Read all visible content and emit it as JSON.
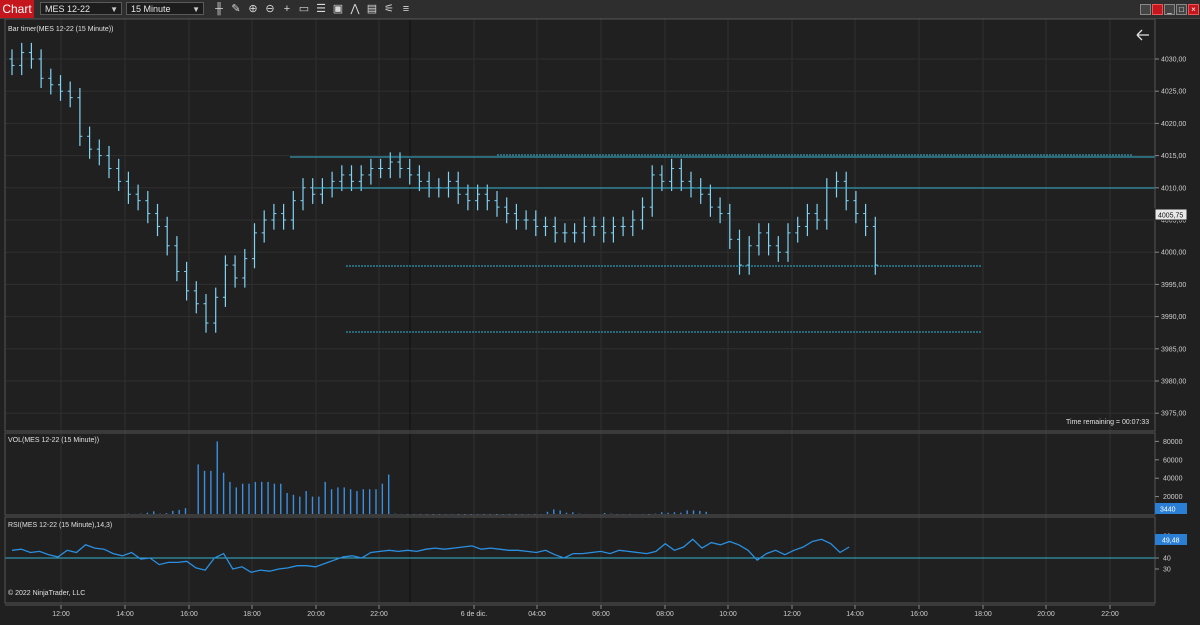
{
  "toolbar": {
    "tab_label": "Chart",
    "instrument": "MES 12-22",
    "interval": "15 Minute",
    "tools": [
      "bar-type-icon",
      "pencil-icon",
      "zoom-in-icon",
      "zoom-out-icon",
      "crosshair-icon",
      "data-box-icon",
      "properties-icon",
      "strategies-icon",
      "indicators-icon",
      "templates-icon",
      "drawing-tools-icon",
      "list-icon"
    ]
  },
  "price_panel": {
    "title": "Bar timer(MES 12-22 (15 Minute))",
    "timer": "Time remaining = 00:07:33",
    "current_price": "4005,75",
    "ticks": [
      "4030,00",
      "4025,00",
      "4020,00",
      "4015,00",
      "4010,00",
      "4005,00",
      "4000,00",
      "3995,00",
      "3990,00",
      "3985,00",
      "3980,00",
      "3975,00"
    ],
    "colors": {
      "bar": "#7fd3f5",
      "line": "#34b3d0",
      "grid": "#2f2f2f"
    }
  },
  "volume_panel": {
    "title": "VOL(MES 12-22 (15 Minute))",
    "current": "3440",
    "ticks": [
      "80000",
      "60000",
      "40000",
      "20000"
    ]
  },
  "rsi_panel": {
    "title": "RSI(MES 12-22 (15 Minute),14,3)",
    "current": "49,48",
    "ticks": [
      "60",
      "40",
      "30"
    ]
  },
  "time_axis": [
    "12:00",
    "14:00",
    "16:00",
    "18:00",
    "20:00",
    "22:00",
    "6 de dic.",
    "04:00",
    "06:00",
    "08:00",
    "10:00",
    "12:00",
    "14:00",
    "16:00",
    "18:00",
    "20:00",
    "22:00"
  ],
  "copyright": "© 2022 NinjaTrader, LLC"
}
